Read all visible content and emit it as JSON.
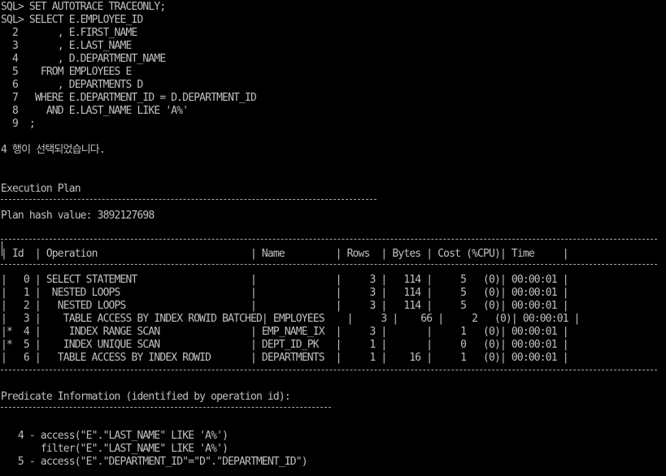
{
  "terminal": {
    "sql_lines": [
      "SQL> SET AUTOTRACE TRACEONLY;",
      "SQL> SELECT E.EMPLOYEE_ID",
      "  2       , E.FIRST_NAME",
      "  3       , E.LAST_NAME",
      "  4       , D.DEPARTMENT_NAME",
      "  5    FROM EMPLOYEES E",
      "  6       , DEPARTMENTS D",
      "  7   WHERE E.DEPARTMENT_ID = D.DEPARTMENT_ID",
      "  8     AND E.LAST_NAME LIKE 'A%'",
      "  9  ;"
    ],
    "rows_selected_message": "4 행이 선택되었습니다.",
    "execution_plan_title": "Execution Plan",
    "plan_hash_value": "Plan hash value: 3892127698",
    "plan_table": {
      "header": "| Id  | Operation                           | Name         | Rows  | Bytes | Cost (%CPU)| Time     |",
      "rows": [
        "|   0 | SELECT STATEMENT                    |              |     3 |   114 |     5   (0)| 00:00:01 |",
        "|   1 |  NESTED LOOPS                       |              |     3 |   114 |     5   (0)| 00:00:01 |",
        "|   2 |   NESTED LOOPS                      |              |     3 |   114 |     5   (0)| 00:00:01 |",
        "|   3 |    TABLE ACCESS BY INDEX ROWID BATCHED| EMPLOYEES    |     3 |    66 |     2   (0)| 00:00:01 |",
        "|*  4 |     INDEX RANGE SCAN                | EMP_NAME_IX  |     3 |       |     1   (0)| 00:00:01 |",
        "|*  5 |    INDEX UNIQUE SCAN                | DEPT_ID_PK   |     1 |       |     0   (0)| 00:00:01 |",
        "|   6 |   TABLE ACCESS BY INDEX ROWID       | DEPARTMENTS  |     1 |    16 |     1   (0)| 00:00:01 |"
      ]
    },
    "predicate_title": "Predicate Information (identified by operation id):",
    "predicate_lines": [
      "   4 - access(\"E\".\"LAST_NAME\" LIKE 'A%')",
      "       filter(\"E\".\"LAST_NAME\" LIKE 'A%')",
      "   5 - access(\"E\".\"DEPARTMENT_ID\"=\"D\".\"DEPARTMENT_ID\")"
    ]
  },
  "colors": {
    "background": "#000000",
    "text": "#c0c0c0"
  }
}
